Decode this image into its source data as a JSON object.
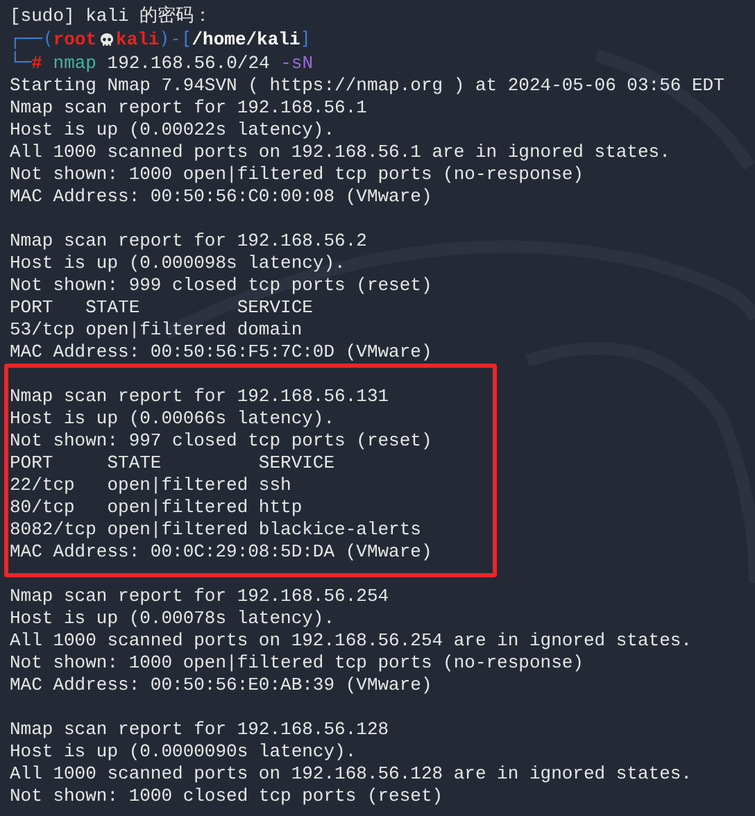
{
  "sudo_prompt": "[sudo] kali 的密码：",
  "prompt": {
    "line1": [
      {
        "kind": "frame",
        "text": "┌──("
      },
      {
        "kind": "user",
        "text": "root"
      },
      {
        "kind": "host",
        "text": "kali"
      },
      {
        "kind": "frame",
        "text": ")-["
      },
      {
        "kind": "path",
        "text": "/home/kali"
      },
      {
        "kind": "frame",
        "text": "]"
      }
    ],
    "line2": [
      {
        "kind": "frame",
        "text": "└─"
      },
      {
        "kind": "symbol",
        "text": "#"
      },
      {
        "kind": "command",
        "text": "nmap"
      },
      {
        "kind": "arg",
        "text": "192.168.56.0/24"
      },
      {
        "kind": "option",
        "text": "-sN"
      }
    ]
  },
  "output": [
    {
      "highlighted": false,
      "lines": [
        "Starting Nmap 7.94SVN ( https://nmap.org ) at 2024-05-06 03:56 EDT",
        "Nmap scan report for 192.168.56.1",
        "Host is up (0.00022s latency).",
        "All 1000 scanned ports on 192.168.56.1 are in ignored states.",
        "Not shown: 1000 open|filtered tcp ports (no-response)",
        "MAC Address: 00:50:56:C0:00:08 (VMware)"
      ]
    },
    {
      "highlighted": false,
      "lines": [
        "Nmap scan report for 192.168.56.2",
        "Host is up (0.000098s latency).",
        "Not shown: 999 closed tcp ports (reset)",
        "PORT   STATE         SERVICE",
        "53/tcp open|filtered domain",
        "MAC Address: 00:50:56:F5:7C:0D (VMware)"
      ]
    },
    {
      "highlighted": true,
      "lines": [
        "Nmap scan report for 192.168.56.131",
        "Host is up (0.00066s latency).",
        "Not shown: 997 closed tcp ports (reset)",
        "PORT     STATE         SERVICE",
        "22/tcp   open|filtered ssh",
        "80/tcp   open|filtered http",
        "8082/tcp open|filtered blackice-alerts",
        "MAC Address: 00:0C:29:08:5D:DA (VMware)"
      ]
    },
    {
      "highlighted": false,
      "lines": [
        "Nmap scan report for 192.168.56.254",
        "Host is up (0.00078s latency).",
        "All 1000 scanned ports on 192.168.56.254 are in ignored states.",
        "Not shown: 1000 open|filtered tcp ports (no-response)",
        "MAC Address: 00:50:56:E0:AB:39 (VMware)"
      ]
    },
    {
      "highlighted": false,
      "lines": [
        "Nmap scan report for 192.168.56.128",
        "Host is up (0.0000090s latency).",
        "All 1000 scanned ports on 192.168.56.128 are in ignored states.",
        "Not shown: 1000 closed tcp ports (reset)"
      ]
    }
  ]
}
